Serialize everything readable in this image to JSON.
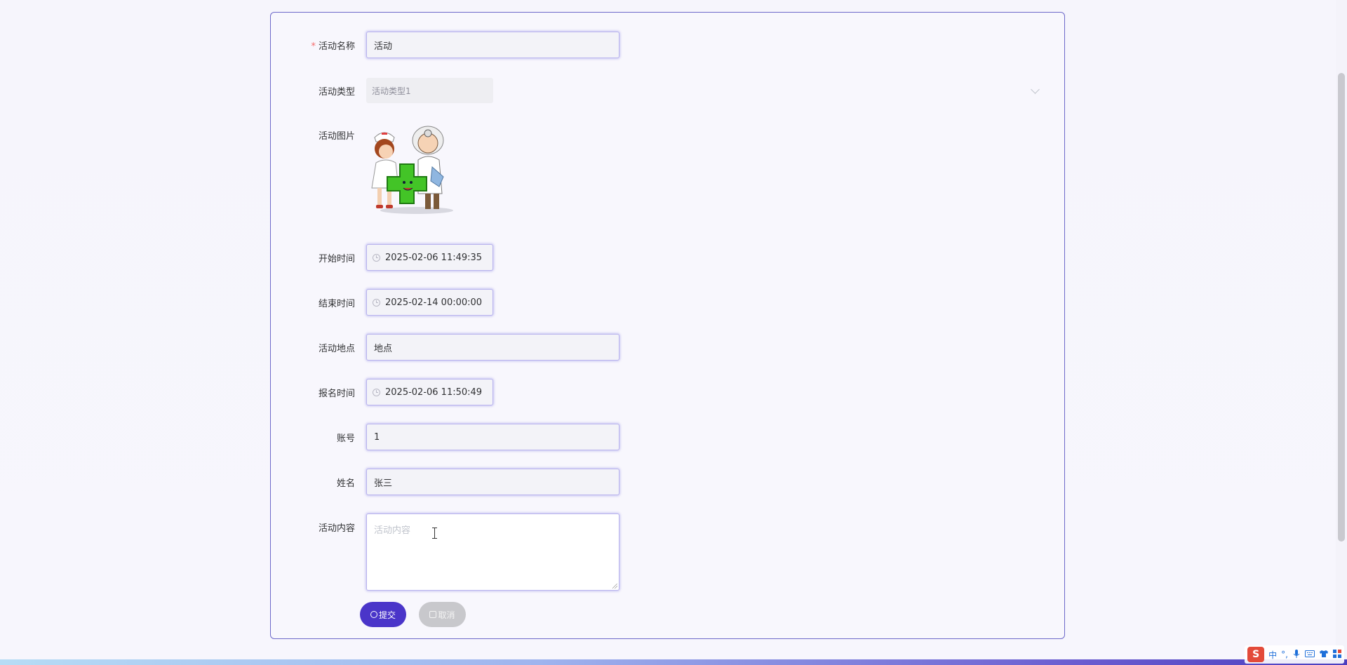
{
  "form": {
    "name": {
      "label": "活动名称",
      "required_mark": "*",
      "value": "活动"
    },
    "type": {
      "label": "活动类型",
      "value": "活动类型1"
    },
    "image": {
      "label": "活动图片"
    },
    "start_time": {
      "label": "开始时间",
      "value": "2025-02-06 11:49:35"
    },
    "end_time": {
      "label": "结束时间",
      "value": "2025-02-14 00:00:00"
    },
    "location": {
      "label": "活动地点",
      "value": "地点"
    },
    "signup_time": {
      "label": "报名时间",
      "value": "2025-02-06 11:50:49"
    },
    "account": {
      "label": "账号",
      "value": "1"
    },
    "full_name": {
      "label": "姓名",
      "value": "张三"
    },
    "content": {
      "label": "活动内容",
      "placeholder": "活动内容"
    }
  },
  "buttons": {
    "submit": "提交",
    "cancel": "取消"
  },
  "ime": {
    "logo": "S",
    "mode": "中",
    "punct": "°,",
    "icons": [
      "mic-icon",
      "keyboard-icon",
      "shirt-icon",
      "grid-icon"
    ]
  },
  "colors": {
    "accent": "#4a35c9",
    "border": "#6d68c9",
    "required": "#f56c6c",
    "cancel": "#c8c8cc"
  }
}
